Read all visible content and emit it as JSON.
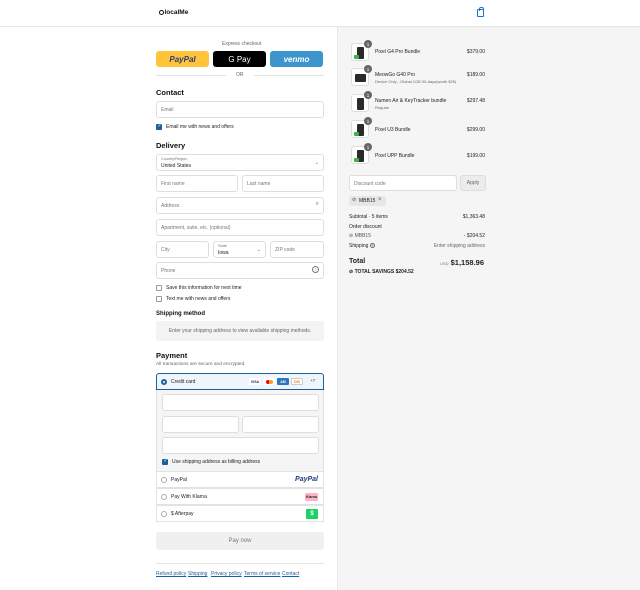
{
  "brand": {
    "name": "localMe"
  },
  "express": {
    "title": "Express checkout",
    "paypal": "PayPal",
    "gpay": "G Pay",
    "venmo": "venmo",
    "or": "OR"
  },
  "contact": {
    "heading": "Contact",
    "email_placeholder": "Email",
    "email_opt_in": "Email me with news and offers"
  },
  "delivery": {
    "heading": "Delivery",
    "country_label": "Country/Region",
    "country_value": "United States",
    "first_name": "First name",
    "last_name": "Last name",
    "address": "Address",
    "apartment": "Apartment, suite, etc. (optional)",
    "city": "City",
    "state_label": "State",
    "state_value": "Iowa",
    "zip": "ZIP code",
    "phone": "Phone",
    "save_info": "Save this information for next time",
    "text_opt_in": "Text me with news and offers"
  },
  "shipping_method": {
    "heading": "Shipping method",
    "message": "Enter your shipping address to view available shipping methods."
  },
  "payment": {
    "heading": "Payment",
    "subtitle": "All transactions are secure and encrypted.",
    "credit_card": "Credit card",
    "card_more": "+7",
    "billing_same": "Use shipping address as billing address",
    "options": [
      {
        "label": "PayPal",
        "logo": "PayPal"
      },
      {
        "label": "Pay With Klarna",
        "logo": "Klarna"
      },
      {
        "label": "$ Afterpay",
        "logo": "$"
      }
    ],
    "pay_now": "Pay now"
  },
  "footer": {
    "links": [
      "Refund policy",
      "Shipping",
      "Privacy policy",
      "Terms of service",
      "Contact"
    ]
  },
  "cart": {
    "items": [
      {
        "name": "Pixel G4 Pro Bundle",
        "sub": "",
        "price": "$379.00",
        "qty": "1"
      },
      {
        "name": "MeowGo G40 Pro",
        "sub": "Device Only - Global 1GB 90-days(worth $29)",
        "price": "$189.00",
        "qty": "1"
      },
      {
        "name": "Numen Air & KeyTracker bundle",
        "sub": "Regular",
        "price": "$297.48",
        "qty": "1"
      },
      {
        "name": "Pixel U3 Bundle",
        "sub": "",
        "price": "$299.00",
        "qty": "1"
      },
      {
        "name": "Pixel UPP Bundle",
        "sub": "",
        "price": "$199.00",
        "qty": "1"
      }
    ],
    "discount_placeholder": "Discount code",
    "apply": "Apply",
    "applied_code": "MBB15",
    "subtotal_label": "Subtotal · 5 items",
    "subtotal": "$1,363.48",
    "order_discount_label": "Order discount",
    "discount_code": "MBB15",
    "discount_amount": "- $204.52",
    "shipping_label": "Shipping",
    "shipping_value": "Enter shipping address",
    "total_label": "Total",
    "currency": "USD",
    "total": "$1,158.96",
    "savings_label": "TOTAL SAVINGS",
    "savings": "$204.52"
  },
  "colors": {
    "paypal_yellow": "#ffc439",
    "venmo_blue": "#3d95ce",
    "accent": "#1d5e9e"
  }
}
